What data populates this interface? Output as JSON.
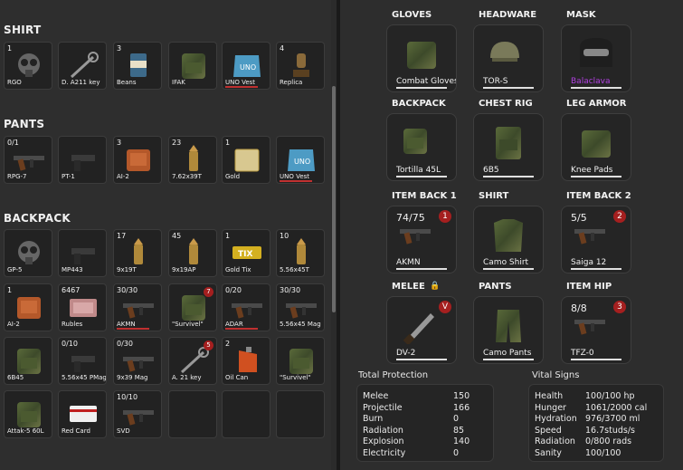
{
  "sections": {
    "shirt": "SHIRT",
    "pants": "PANTS",
    "backpack": "BACKPACK"
  },
  "shirt_items": [
    {
      "count": "1",
      "label": "RGO",
      "bar": "",
      "badge": ""
    },
    {
      "count": "",
      "label": "D. A211 key",
      "bar": "",
      "badge": ""
    },
    {
      "count": "3",
      "label": "Beans",
      "bar": "",
      "badge": ""
    },
    {
      "count": "",
      "label": "IFAK",
      "bar": "",
      "badge": ""
    },
    {
      "count": "",
      "label": "UNO Vest",
      "bar": "red",
      "badge": ""
    },
    {
      "count": "4",
      "label": "Replica",
      "bar": "",
      "badge": ""
    }
  ],
  "pants_items": [
    {
      "count": "0/1",
      "label": "RPG-7",
      "bar": "",
      "badge": ""
    },
    {
      "count": "",
      "label": "PT-1",
      "bar": "",
      "badge": ""
    },
    {
      "count": "3",
      "label": "AI-2",
      "bar": "",
      "badge": ""
    },
    {
      "count": "23",
      "label": "7.62x39T",
      "bar": "",
      "badge": ""
    },
    {
      "count": "1",
      "label": "Gold",
      "bar": "",
      "badge": ""
    },
    {
      "count": "",
      "label": "UNO Vest",
      "bar": "red",
      "badge": ""
    }
  ],
  "backpack_items": [
    {
      "count": "",
      "label": "GP-5",
      "bar": "",
      "badge": ""
    },
    {
      "count": "",
      "label": "MP443",
      "bar": "",
      "badge": ""
    },
    {
      "count": "17",
      "label": "9x19T",
      "bar": "",
      "badge": ""
    },
    {
      "count": "45",
      "label": "9x19AP",
      "bar": "",
      "badge": ""
    },
    {
      "count": "1",
      "label": "Gold Tix",
      "bar": "",
      "badge": ""
    },
    {
      "count": "10",
      "label": "5.56x45T",
      "bar": "",
      "badge": ""
    },
    {
      "count": "1",
      "label": "AI-2",
      "bar": "",
      "badge": ""
    },
    {
      "count": "6467",
      "label": "Rubles",
      "bar": "",
      "badge": ""
    },
    {
      "count": "30/30",
      "label": "AKMN",
      "bar": "red",
      "badge": ""
    },
    {
      "count": "",
      "label": "\"Survivel\"",
      "bar": "",
      "badge": "7"
    },
    {
      "count": "0/20",
      "label": "ADAR",
      "bar": "red",
      "badge": ""
    },
    {
      "count": "30/30",
      "label": "5.56x45 Mag",
      "bar": "",
      "badge": ""
    },
    {
      "count": "",
      "label": "6B45",
      "bar": "",
      "badge": ""
    },
    {
      "count": "0/10",
      "label": "5.56x45 PMag",
      "bar": "",
      "badge": ""
    },
    {
      "count": "0/30",
      "label": "9x39 Mag",
      "bar": "",
      "badge": ""
    },
    {
      "count": "",
      "label": "A. 21 key",
      "bar": "",
      "badge": "5"
    },
    {
      "count": "2",
      "label": "Oil Can",
      "bar": "",
      "badge": ""
    },
    {
      "count": "",
      "label": "\"Survivel\"",
      "bar": "",
      "badge": ""
    },
    {
      "count": "",
      "label": "Attak-5 60L",
      "bar": "",
      "badge": ""
    },
    {
      "count": "",
      "label": "Red Card",
      "bar": "",
      "badge": ""
    },
    {
      "count": "10/10",
      "label": "SVD",
      "bar": "",
      "badge": ""
    },
    {
      "count": "",
      "label": "",
      "bar": "",
      "badge": ""
    },
    {
      "count": "",
      "label": "",
      "bar": "",
      "badge": ""
    },
    {
      "count": "",
      "label": "",
      "bar": "",
      "badge": ""
    }
  ],
  "equipment": [
    {
      "head": "GLOVES",
      "label": "Combat Gloves",
      "count": "",
      "badge": "",
      "purple": false
    },
    {
      "head": "HEADWARE",
      "label": "TOR-S",
      "count": "",
      "badge": "",
      "purple": false
    },
    {
      "head": "MASK",
      "label": "Balaclava",
      "count": "",
      "badge": "",
      "purple": true
    },
    {
      "head": "BACKPACK",
      "label": "Tortilla 45L",
      "count": "",
      "badge": "",
      "purple": false
    },
    {
      "head": "CHEST RIG",
      "label": "6B5",
      "count": "",
      "badge": "",
      "purple": false
    },
    {
      "head": "LEG ARMOR",
      "label": "Knee Pads",
      "count": "",
      "badge": "",
      "purple": false
    },
    {
      "head": "ITEM BACK 1",
      "label": "AKMN",
      "count": "74/75",
      "badge": "1",
      "purple": false
    },
    {
      "head": "SHIRT",
      "label": "Camo Shirt",
      "count": "",
      "badge": "",
      "purple": false
    },
    {
      "head": "ITEM BACK 2",
      "label": "Saiga 12",
      "count": "5/5",
      "badge": "2",
      "purple": false
    },
    {
      "head": "MELEE",
      "label": "DV-2",
      "count": "",
      "badge": "V",
      "purple": false
    },
    {
      "head": "PANTS",
      "label": "Camo Pants",
      "count": "",
      "badge": "",
      "purple": false
    },
    {
      "head": "ITEM HIP",
      "label": "TFZ-0",
      "count": "8/8",
      "badge": "3",
      "purple": false
    }
  ],
  "protection": {
    "title": "Total Protection",
    "rows": [
      {
        "name": "Melee",
        "value": "150"
      },
      {
        "name": "Projectile",
        "value": "166"
      },
      {
        "name": "Burn",
        "value": "0"
      },
      {
        "name": "Radiation",
        "value": "85"
      },
      {
        "name": "Explosion",
        "value": "140"
      },
      {
        "name": "Electricity",
        "value": "0"
      }
    ]
  },
  "vitals": {
    "title": "Vital Signs",
    "rows": [
      {
        "name": "Health",
        "value": "100/100 hp"
      },
      {
        "name": "Hunger",
        "value": "1061/2000 cal"
      },
      {
        "name": "Hydration",
        "value": "976/3700 ml"
      },
      {
        "name": "Speed",
        "value": "16.7studs/s"
      },
      {
        "name": "Radiation",
        "value": "0/800 rads"
      },
      {
        "name": "Sanity",
        "value": "100/100"
      }
    ]
  },
  "colors": {
    "badge": "#a51f1f",
    "rare": "#b040e0",
    "bar_red": "#c03030"
  }
}
